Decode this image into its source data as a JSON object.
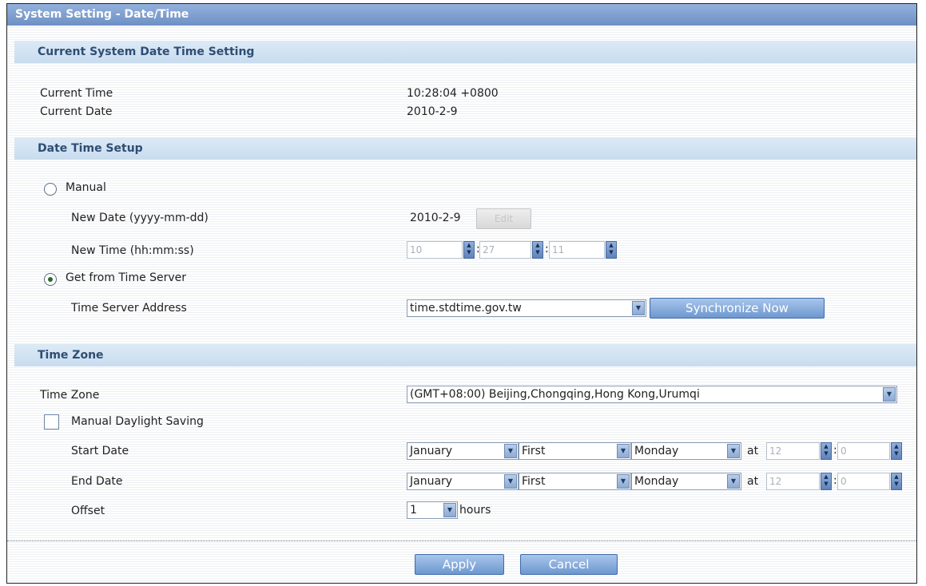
{
  "title": "System Setting - Date/Time",
  "current": {
    "header": "Current System Date Time Setting",
    "time_label": "Current Time",
    "time_value": "10:28:04 +0800",
    "date_label": "Current Date",
    "date_value": "2010-2-9"
  },
  "setup": {
    "header": "Date Time Setup",
    "manual_label": "Manual",
    "manual_selected": false,
    "new_date_label": "New Date (yyyy-mm-dd)",
    "new_date_value": "2010-2-9",
    "edit_label": "Edit",
    "new_time_label": "New Time (hh:mm:ss)",
    "hour": "10",
    "minute": "27",
    "second": "11",
    "time_sep": ":",
    "server_label": "Get from Time Server",
    "server_selected": true,
    "server_address_label": "Time Server Address",
    "server_address": "time.stdtime.gov.tw",
    "sync_label": "Synchronize Now"
  },
  "timezone": {
    "header": "Time Zone",
    "label": "Time Zone",
    "value": "(GMT+08:00) Beijing,Chongqing,Hong Kong,Urumqi",
    "dst_label": "Manual Daylight Saving",
    "dst_checked": false,
    "start_label": "Start Date",
    "end_label": "End Date",
    "offset_label": "Offset",
    "start": {
      "month": "January",
      "week": "First",
      "day": "Monday",
      "at": "at",
      "hour": "12",
      "minute": "0"
    },
    "end": {
      "month": "January",
      "week": "First",
      "day": "Monday",
      "at": "at",
      "hour": "12",
      "minute": "0"
    },
    "offset_value": "1",
    "offset_unit": "hours"
  },
  "footer": {
    "apply_label": "Apply",
    "cancel_label": "Cancel"
  },
  "icons": {
    "dropdown": "chevron-down-icon",
    "spinner": "up-down-spinner-icon"
  },
  "colors": {
    "title_bar": "#7e9fd0",
    "section_header": "#d2e3f3",
    "section_text": "#2f4d73",
    "button": "#6d97d0"
  }
}
